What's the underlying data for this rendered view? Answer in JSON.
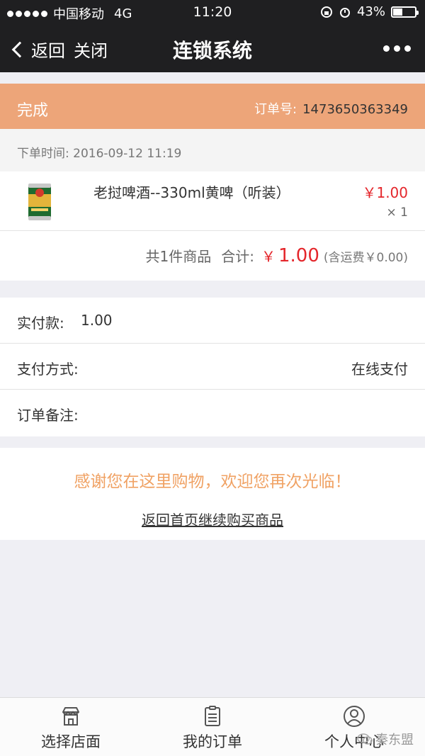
{
  "status_bar": {
    "carrier": "中国移动",
    "network": "4G",
    "time": "11:20",
    "battery": "43%",
    "battery_level": 0.43
  },
  "nav": {
    "back_label": "返回",
    "close_label": "关闭",
    "title": "连锁系统",
    "more_icon": "more-dots-icon"
  },
  "order": {
    "status": "完成",
    "number_label": "订单号:",
    "number": "1473650363349",
    "time_label": "下单时间:",
    "time": "2016-09-12 11:19"
  },
  "items": [
    {
      "name": "老挝啤酒--330ml黄啤（听装）",
      "price": "￥1.00",
      "quantity": "× 1",
      "image": "beer-can"
    }
  ],
  "summary": {
    "count_text": "共1件商品",
    "total_label": "合计:",
    "currency": "￥",
    "total_amount": "1.00",
    "shipping_note": "(含运费￥0.00)"
  },
  "payment": {
    "paid_label": "实付款:",
    "paid_value": "1.00",
    "method_label": "支付方式:",
    "method_value": "在线支付",
    "note_label": "订单备注:",
    "note_value": ""
  },
  "thanks": {
    "message": "感谢您在这里购物，欢迎您再次光临！",
    "link_label": "返回首页继续购买商品"
  },
  "tabbar": {
    "tabs": [
      {
        "label": "选择店面",
        "icon": "store-icon"
      },
      {
        "label": "我的订单",
        "icon": "order-list-icon"
      },
      {
        "label": "个人中心",
        "icon": "user-icon"
      }
    ]
  },
  "watermark": "秦东盟",
  "colors": {
    "nav_bg": "#1f1f21",
    "header_bg": "#eda579",
    "price_red": "#e4262b",
    "thanks_orange": "#f0a264"
  }
}
